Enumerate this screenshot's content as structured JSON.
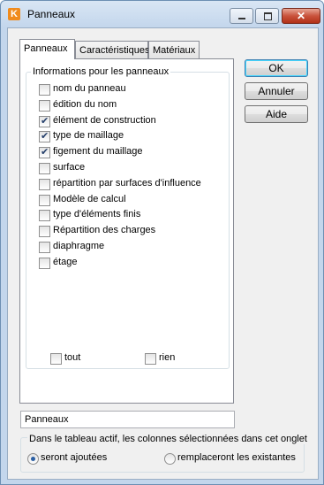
{
  "window": {
    "title": "Panneaux",
    "close_glyph": "✕",
    "app_icon_letter": "K"
  },
  "tabs": [
    {
      "label": "Panneaux"
    },
    {
      "label": "Caractéristiques"
    },
    {
      "label": "Matériaux"
    }
  ],
  "group": {
    "label": "Informations pour les panneaux",
    "items": [
      {
        "label": "nom du panneau",
        "checked": false
      },
      {
        "label": "édition du nom",
        "checked": false
      },
      {
        "label": "élément de construction",
        "checked": true
      },
      {
        "label": "type de maillage",
        "checked": true
      },
      {
        "label": "figement du maillage",
        "checked": true
      },
      {
        "label": "surface",
        "checked": false
      },
      {
        "label": "répartition par surfaces d'influence",
        "checked": false
      },
      {
        "label": "Modèle de calcul",
        "checked": false
      },
      {
        "label": "type d'éléments finis",
        "checked": false
      },
      {
        "label": "Répartition des charges",
        "checked": false
      },
      {
        "label": "diaphragme",
        "checked": false
      },
      {
        "label": "étage",
        "checked": false
      }
    ],
    "all_label": "tout",
    "none_label": "rien"
  },
  "buttons": {
    "ok": "OK",
    "cancel": "Annuler",
    "help": "Aide"
  },
  "name_field": {
    "value": "Panneaux"
  },
  "bottom": {
    "label": "Dans le tableau actif, les colonnes sélectionnées dans cet onglet",
    "option_add": "seront ajoutées",
    "option_replace": "remplaceront les existantes",
    "selected": "seront ajoutées"
  },
  "colors": {
    "title_bar": "#c3d6ec",
    "accent": "#3c7fb1",
    "close_button": "#c9533c"
  }
}
